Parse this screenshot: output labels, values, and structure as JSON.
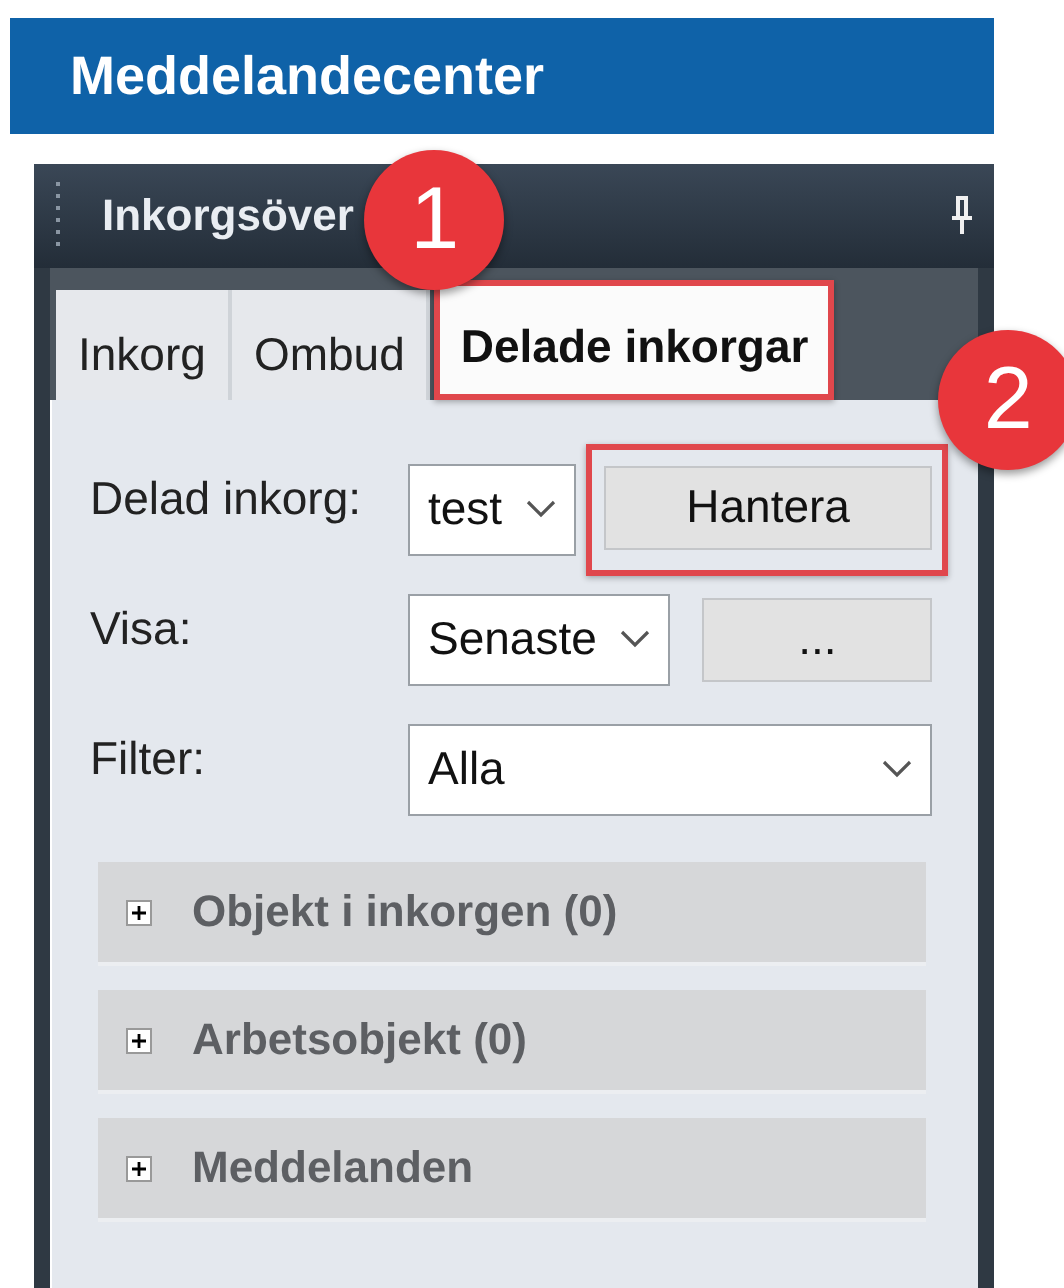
{
  "header": {
    "title": "Meddelandecenter"
  },
  "panel": {
    "title": "Inkorgsöver",
    "tabs": [
      {
        "label": "Inkorg",
        "selected": false,
        "highlighted": false
      },
      {
        "label": "Ombud",
        "selected": false,
        "highlighted": false
      },
      {
        "label": "Delade inkorgar",
        "selected": true,
        "highlighted": true,
        "callout": "1"
      }
    ],
    "rows": [
      {
        "label": "Delad inkorg:",
        "select": {
          "value": "test"
        },
        "button": {
          "label": "Hantera",
          "highlighted": true,
          "callout": "2"
        }
      },
      {
        "label": "Visa:",
        "select": {
          "value": "Senaste"
        },
        "button": {
          "label": "...",
          "highlighted": false
        }
      },
      {
        "label": "Filter:",
        "select": {
          "value": "Alla"
        }
      }
    ],
    "sections": [
      {
        "label": "Objekt i inkorgen (0)",
        "expanded": false
      },
      {
        "label": "Arbetsobjekt (0)",
        "expanded": false
      },
      {
        "label": "Meddelanden",
        "expanded": false
      }
    ]
  }
}
